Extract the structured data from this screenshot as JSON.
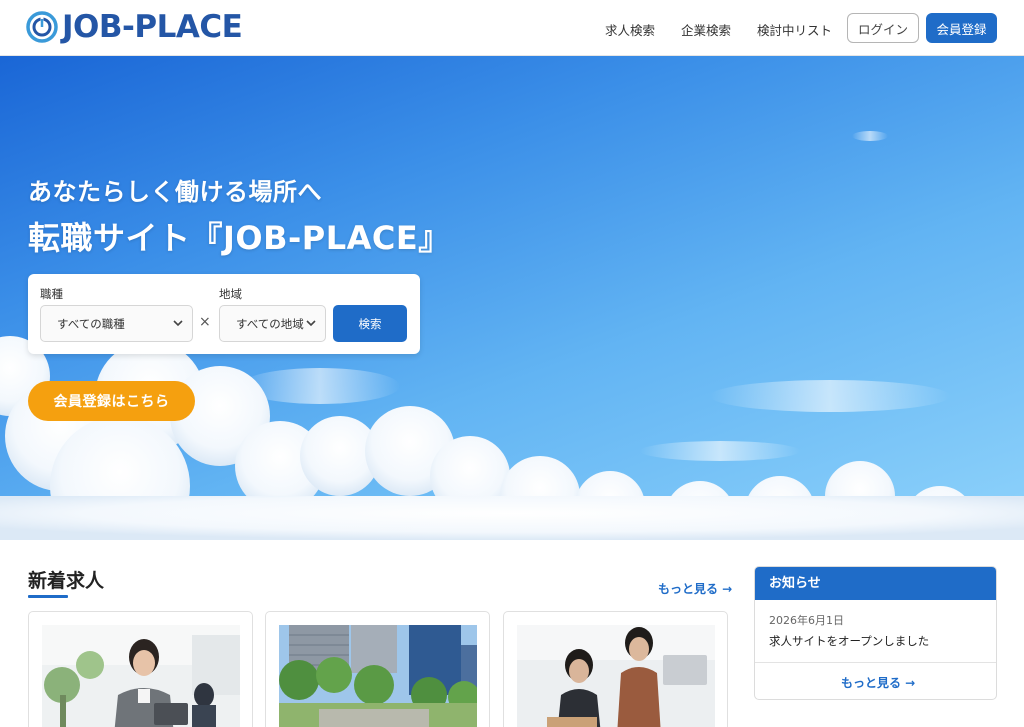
{
  "header": {
    "logo_text": "JOB-PLACE",
    "nav": [
      "求人検索",
      "企業検索",
      "検討中リスト"
    ],
    "login_label": "ログイン",
    "register_label": "会員登録"
  },
  "hero": {
    "subtitle": "あなたらしく働ける場所へ",
    "title": "転職サイト『JOB-PLACE』",
    "search": {
      "job_label": "職種",
      "job_value": "すべての職種",
      "times": "×",
      "area_label": "地域",
      "area_value": "すべての地域",
      "search_label": "検索"
    },
    "cta_label": "会員登録はこちら"
  },
  "new_jobs": {
    "title": "新着求人",
    "more_label": "もっと見る →"
  },
  "news": {
    "title": "お知らせ",
    "items": [
      {
        "date": "2026年6月1日",
        "text": "求人サイトをオープンしました"
      }
    ],
    "more_label": "もっと見る →"
  },
  "colors": {
    "brand": "#2456a6",
    "primary": "#1f6cc8",
    "accent": "#f5a00f"
  }
}
